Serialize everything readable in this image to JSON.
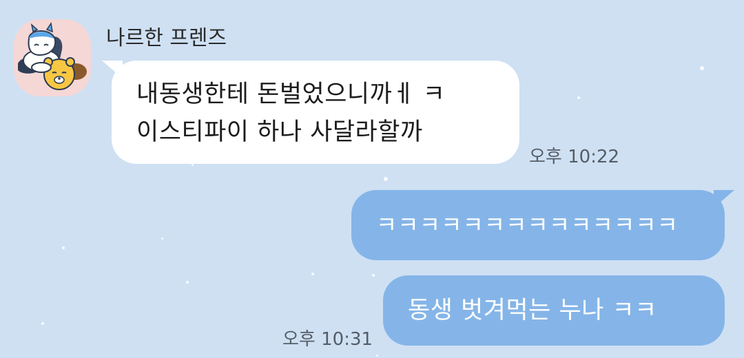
{
  "chat": {
    "background_color": "#cfe0f3",
    "incoming_bubble_color": "#ffffff",
    "outgoing_bubble_color": "#85b5e8"
  },
  "sender": {
    "name": "나르한 프렌즈",
    "avatar_icon": "profile-character-icon"
  },
  "messages": [
    {
      "direction": "incoming",
      "lines": [
        "내동생한테 돈벌었으니까ㅔ ㅋ",
        "이스티파이 하나 사달라할까"
      ],
      "time": "오후 10:22"
    },
    {
      "direction": "outgoing",
      "text": "ㅋㅋㅋㅋㅋㅋㅋㅋㅋㅋㅋㅋㅋㅋ"
    },
    {
      "direction": "outgoing",
      "text": "동생 벗겨먹는 누나 ㅋㅋ",
      "time": "오후 10:31"
    }
  ]
}
